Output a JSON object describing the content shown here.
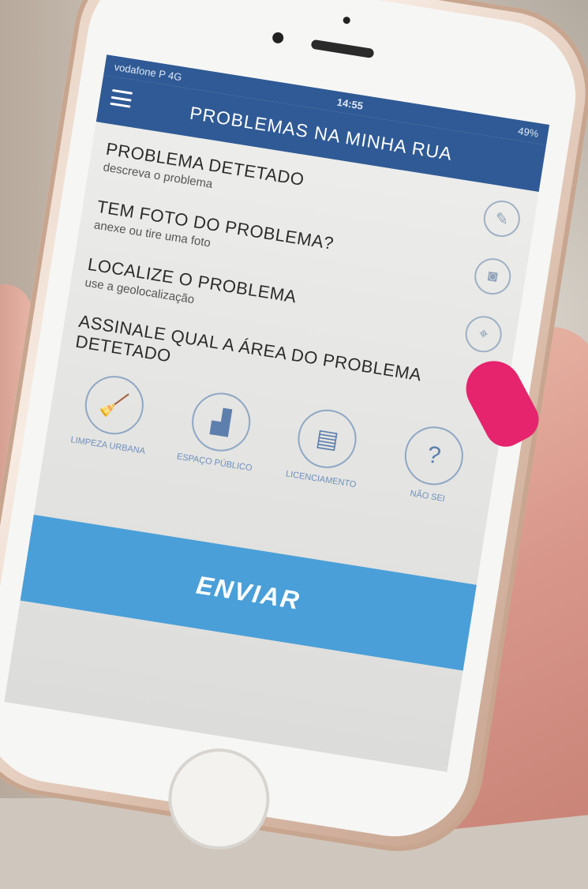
{
  "status_bar": {
    "carrier": "vodafone P 4G",
    "time": "14:55",
    "battery": "49%"
  },
  "header": {
    "title": "PROBLEMAS NA MINHA RUA",
    "menu_icon": "hamburger-menu-icon"
  },
  "form": {
    "fields": [
      {
        "title": "PROBLEMA DETETADO",
        "subtitle": "descreva o problema",
        "icon": "pencil-icon"
      },
      {
        "title": "TEM FOTO DO PROBLEMA?",
        "subtitle": "anexe ou tire uma foto",
        "icon": "camera-icon"
      },
      {
        "title": "LOCALIZE O PROBLEMA",
        "subtitle": "use a geolocalização",
        "icon": "location-icon"
      }
    ],
    "area_title": "ASSINALE QUAL A ÁREA DO PROBLEMA DETETADO",
    "areas": [
      {
        "label": "LIMPEZA URBANA",
        "icon": "broom-icon"
      },
      {
        "label": "ESPAÇO PÚBLICO",
        "icon": "building-icon"
      },
      {
        "label": "LICENCIAMENTO",
        "icon": "document-icon"
      },
      {
        "label": "NÃO SEI",
        "icon": "question-icon"
      }
    ]
  },
  "send_button": {
    "label": "ENVIAR"
  },
  "colors": {
    "header_blue": "#2f5a95",
    "button_blue": "#4a9fd8",
    "nail_pink": "#e6246d"
  }
}
